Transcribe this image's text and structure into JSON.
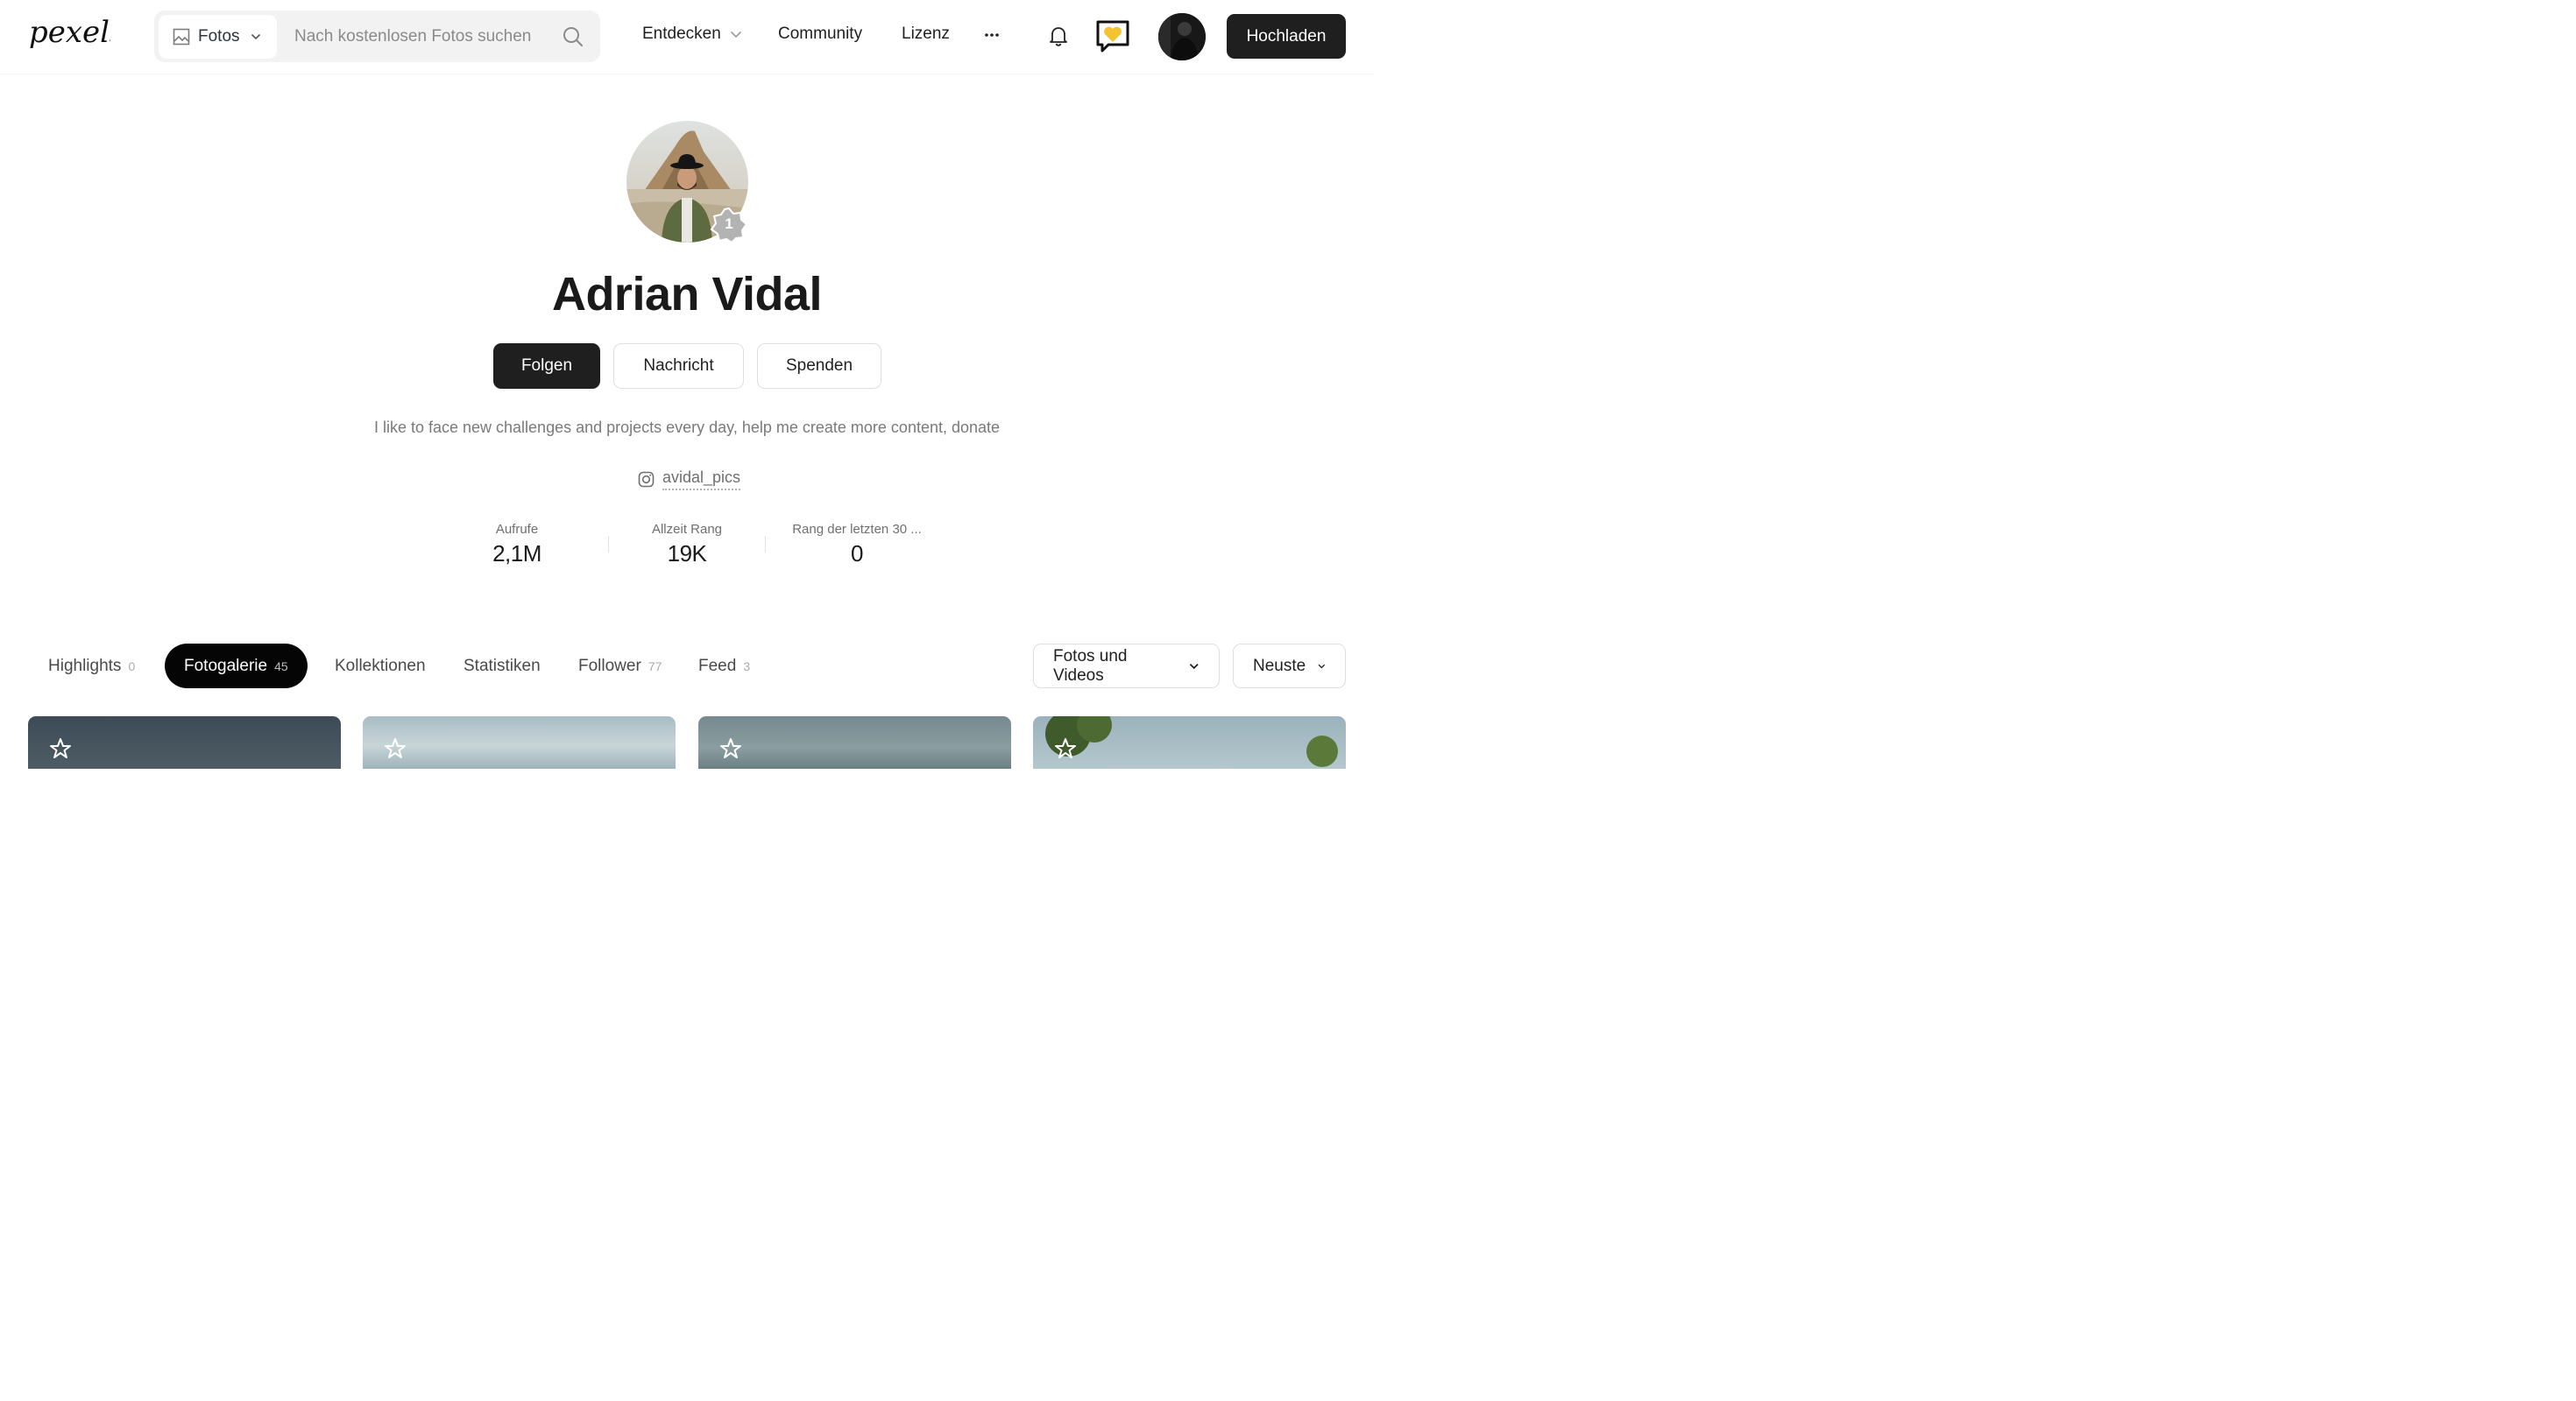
{
  "header": {
    "logo_text": "pexels",
    "type_select_label": "Fotos",
    "search_placeholder": "Nach kostenlosen Fotos suchen",
    "nav": {
      "discover": "Entdecken",
      "community": "Community",
      "license": "Lizenz"
    },
    "upload_label": "Hochladen"
  },
  "profile": {
    "name": "Adrian Vidal",
    "rank_badge": "1",
    "buttons": {
      "follow": "Folgen",
      "message": "Nachricht",
      "donate": "Spenden"
    },
    "bio": "I like to face new challenges and projects every day, help me create more content, donate",
    "instagram": "avidal_pics",
    "stats": [
      {
        "label": "Aufrufe",
        "value": "2,1M"
      },
      {
        "label": "Allzeit Rang",
        "value": "19K"
      },
      {
        "label": "Rang der letzten 30 ...",
        "value": "0"
      }
    ]
  },
  "tabs": [
    {
      "label": "Highlights",
      "count": "0"
    },
    {
      "label": "Fotogalerie",
      "count": "45"
    },
    {
      "label": "Kollektionen",
      "count": ""
    },
    {
      "label": "Statistiken",
      "count": ""
    },
    {
      "label": "Follower",
      "count": "77"
    },
    {
      "label": "Feed",
      "count": "3"
    }
  ],
  "filters": {
    "media_type": "Fotos und Videos",
    "sort": "Neuste"
  },
  "colors": {
    "primary_dark": "#1f1f1f",
    "highlight_gold": "#f4c430",
    "muted_text": "#7a7a7a"
  },
  "icons": [
    "image-icon",
    "chevron-down-icon",
    "search-icon",
    "more-icon",
    "bell-icon",
    "heart-chat-icon",
    "instagram-icon",
    "star-icon"
  ]
}
